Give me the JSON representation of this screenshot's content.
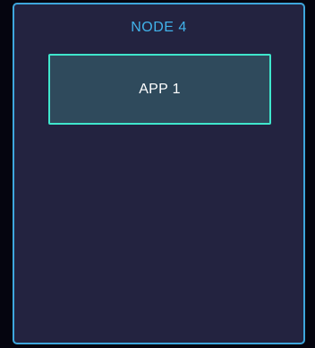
{
  "node": {
    "title": "NODE 4",
    "border_color": "#3ea6dc",
    "background_color": "#232340",
    "title_color": "#41b2ea"
  },
  "apps": [
    {
      "label": "APP 1",
      "border_color": "#3fe6cc",
      "background_color": "#2f4a5c"
    }
  ]
}
